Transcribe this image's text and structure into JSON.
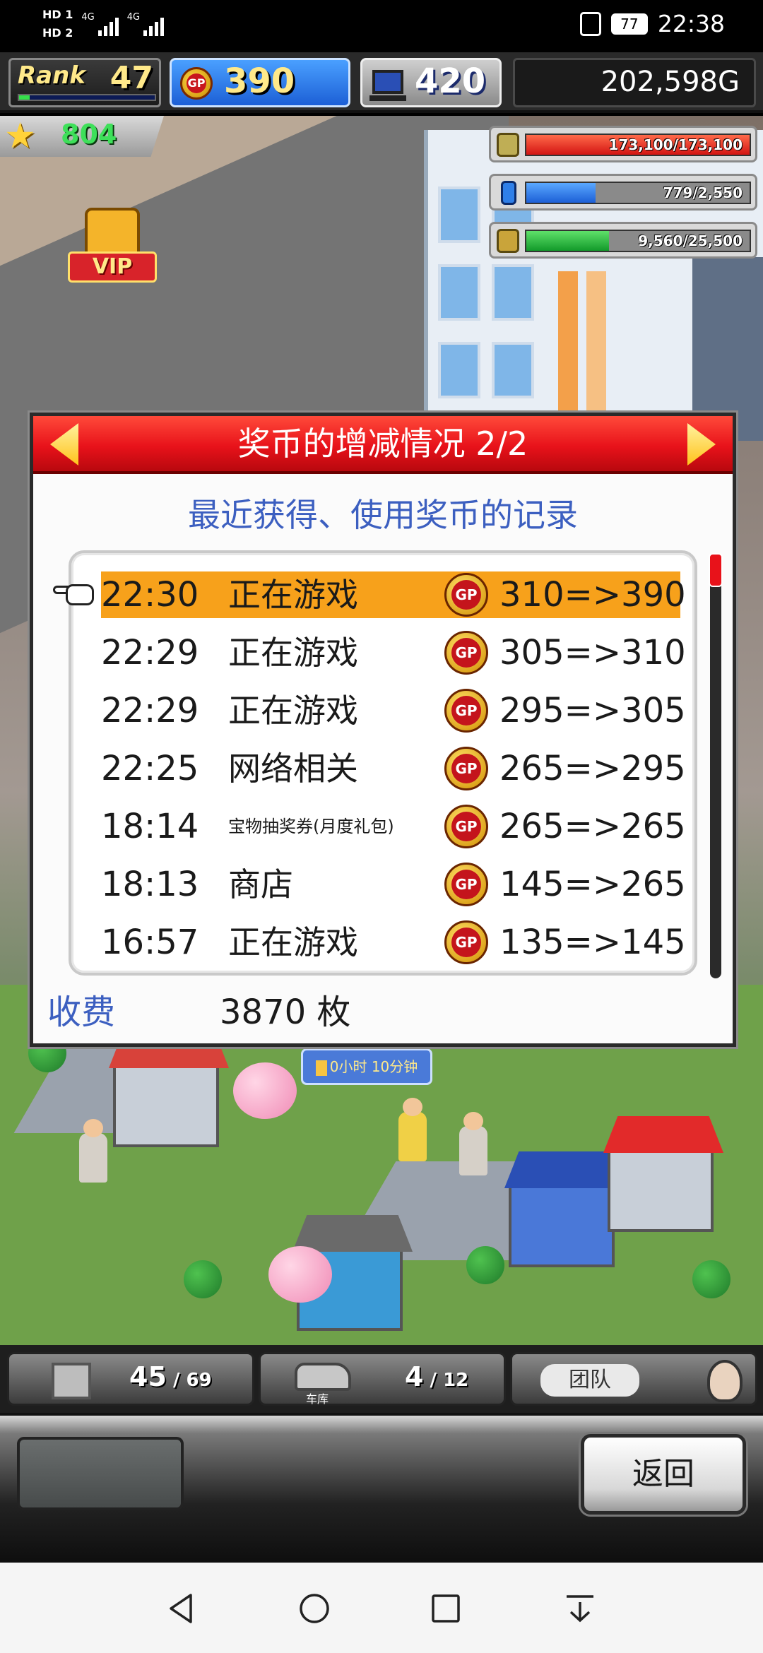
{
  "status_bar": {
    "hd_top": "HD 1",
    "hd_bottom": "HD 2",
    "net1": "4G",
    "net2": "4G",
    "battery": "77",
    "clock": "22:38"
  },
  "hud": {
    "rank_label": "Rank",
    "rank_value": "47",
    "gp_icon_text": "GP",
    "gp_value": "390",
    "research_value": "420",
    "money": "202,598G"
  },
  "world": {
    "star_count": "804",
    "vip_label": "VIP",
    "timer_text": "0小时 10分钟",
    "resources": [
      {
        "icon": "coin-stack-icon",
        "value": "173,100/173,100",
        "fill": 1.0,
        "color": "#e8281e"
      },
      {
        "icon": "bottle-icon",
        "value": "779/2,550",
        "fill": 0.31,
        "color": "#2f7fe8"
      },
      {
        "icon": "wheat-icon",
        "value": "9,560/25,500",
        "fill": 0.37,
        "color": "#21b23a"
      }
    ]
  },
  "dialog": {
    "title": "奖币的增减情况 2/2",
    "subtitle": "最近获得、使用奖币的记录",
    "coin_text": "GP",
    "records": [
      {
        "time": "22:30",
        "desc": "正在游戏",
        "change": "310=>390"
      },
      {
        "time": "22:29",
        "desc": "正在游戏",
        "change": "305=>310"
      },
      {
        "time": "22:29",
        "desc": "正在游戏",
        "change": "295=>305"
      },
      {
        "time": "22:25",
        "desc": "网络相关",
        "change": "265=>295"
      },
      {
        "time": "18:14",
        "desc": "宝物抽奖券(月度礼包)",
        "change": "265=>265"
      },
      {
        "time": "18:13",
        "desc": "商店",
        "change": "145=>265"
      },
      {
        "time": "16:57",
        "desc": "正在游戏",
        "change": "135=>145"
      }
    ],
    "fee_label": "收费",
    "fee_value": "3870 枚"
  },
  "tabbar": {
    "buildings_count": "45",
    "buildings_max": "69",
    "garage_label": "车库",
    "garage_count": "4",
    "garage_max": "12",
    "team_label": "团队"
  },
  "commands": {
    "back_label": "返回"
  },
  "colors": {
    "dialog_header": "#e8121a",
    "selected_row": "#f7a11b",
    "subtitle_blue": "#3c5fc0"
  }
}
